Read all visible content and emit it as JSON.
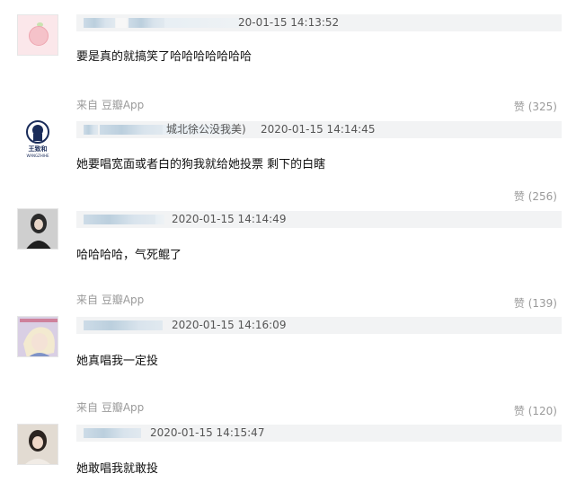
{
  "comments": [
    {
      "avatar": "peach-avatar",
      "time": "20-01-15 14:13:52",
      "text": "要是真的就搞笑了哈哈哈哈哈哈哈",
      "source": "",
      "like": ""
    },
    {
      "avatar": "wangzhihe-logo-avatar",
      "reply_to": "城北徐公没我美)",
      "time": "2020-01-15 14:14:45",
      "text": "她要唱宽面或者白的狗我就给她投票 剩下的白瞎",
      "source": "来自 豆瓣App",
      "like": "赞 (325)"
    },
    {
      "avatar": "girl-avatar",
      "time": "2020-01-15 14:14:49",
      "text": "哈哈哈哈，气死鲲了",
      "source": "",
      "like": "赞 (256)"
    },
    {
      "avatar": "cartoon-girl-avatar",
      "time": "2020-01-15 14:16:09",
      "text": "她真唱我一定投",
      "source": "来自 豆瓣App",
      "like": "赞 (139)"
    },
    {
      "avatar": "portrait-avatar",
      "time": "2020-01-15 14:15:47",
      "text": "她敢唱我就敢投",
      "source": "来自 豆瓣App",
      "like": "赞 (120)"
    }
  ],
  "brand_logo_text": "王致和",
  "brand_logo_sub": "WANGZHIHE"
}
